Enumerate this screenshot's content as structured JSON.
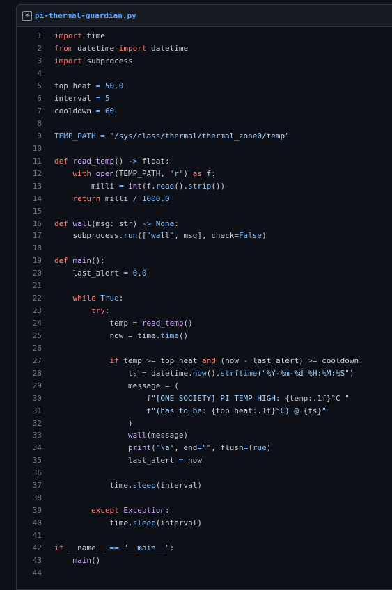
{
  "header": {
    "filename": "pi-thermal-guardian.py",
    "icon": "code-file-icon"
  },
  "code": {
    "lines": [
      [
        [
          "kw",
          "import"
        ],
        [
          "pl",
          " time"
        ]
      ],
      [
        [
          "kw",
          "from"
        ],
        [
          "pl",
          " datetime "
        ],
        [
          "kw",
          "import"
        ],
        [
          "pl",
          " datetime"
        ]
      ],
      [
        [
          "kw",
          "import"
        ],
        [
          "pl",
          " subprocess"
        ]
      ],
      [],
      [
        [
          "pl",
          "top_heat "
        ],
        [
          "op",
          "="
        ],
        [
          "pl",
          " "
        ],
        [
          "num",
          "50.0"
        ]
      ],
      [
        [
          "pl",
          "interval "
        ],
        [
          "op",
          "="
        ],
        [
          "pl",
          " "
        ],
        [
          "num",
          "5"
        ]
      ],
      [
        [
          "pl",
          "cooldown "
        ],
        [
          "op",
          "="
        ],
        [
          "pl",
          " "
        ],
        [
          "num",
          "60"
        ]
      ],
      [],
      [
        [
          "num",
          "TEMP_PATH"
        ],
        [
          "pl",
          " "
        ],
        [
          "op",
          "="
        ],
        [
          "pl",
          " "
        ],
        [
          "str",
          "\"/sys/class/thermal/thermal_zone0/temp\""
        ]
      ],
      [],
      [
        [
          "kw",
          "def"
        ],
        [
          "pl",
          " "
        ],
        [
          "fn",
          "read_temp"
        ],
        [
          "pl",
          "() "
        ],
        [
          "op",
          "->"
        ],
        [
          "pl",
          " float:"
        ]
      ],
      [
        [
          "pl",
          "    "
        ],
        [
          "kw",
          "with"
        ],
        [
          "pl",
          " "
        ],
        [
          "fn",
          "open"
        ],
        [
          "pl",
          "(TEMP_PATH, "
        ],
        [
          "str",
          "\"r\""
        ],
        [
          "pl",
          ") "
        ],
        [
          "kw",
          "as"
        ],
        [
          "pl",
          " f:"
        ]
      ],
      [
        [
          "pl",
          "        milli "
        ],
        [
          "op",
          "="
        ],
        [
          "pl",
          " "
        ],
        [
          "fn",
          "int"
        ],
        [
          "pl",
          "(f."
        ],
        [
          "mth",
          "read"
        ],
        [
          "pl",
          "()."
        ],
        [
          "mth",
          "strip"
        ],
        [
          "pl",
          "())"
        ]
      ],
      [
        [
          "pl",
          "    "
        ],
        [
          "kw",
          "return"
        ],
        [
          "pl",
          " milli "
        ],
        [
          "op",
          "/"
        ],
        [
          "pl",
          " "
        ],
        [
          "num",
          "1000.0"
        ]
      ],
      [],
      [
        [
          "kw",
          "def"
        ],
        [
          "pl",
          " "
        ],
        [
          "fn",
          "wall"
        ],
        [
          "pl",
          "(msg: str) "
        ],
        [
          "op",
          "->"
        ],
        [
          "pl",
          " "
        ],
        [
          "bi",
          "None"
        ],
        [
          "pl",
          ":"
        ]
      ],
      [
        [
          "pl",
          "    subprocess."
        ],
        [
          "mth",
          "run"
        ],
        [
          "pl",
          "(["
        ],
        [
          "str",
          "\"wall\""
        ],
        [
          "pl",
          ", msg], check"
        ],
        [
          "op",
          "="
        ],
        [
          "bi",
          "False"
        ],
        [
          "pl",
          ")"
        ]
      ],
      [],
      [
        [
          "kw",
          "def"
        ],
        [
          "pl",
          " "
        ],
        [
          "fn",
          "main"
        ],
        [
          "pl",
          "():"
        ]
      ],
      [
        [
          "pl",
          "    last_alert "
        ],
        [
          "op",
          "="
        ],
        [
          "pl",
          " "
        ],
        [
          "num",
          "0.0"
        ]
      ],
      [],
      [
        [
          "pl",
          "    "
        ],
        [
          "kw",
          "while"
        ],
        [
          "pl",
          " "
        ],
        [
          "bi",
          "True"
        ],
        [
          "pl",
          ":"
        ]
      ],
      [
        [
          "pl",
          "        "
        ],
        [
          "kw",
          "try"
        ],
        [
          "pl",
          ":"
        ]
      ],
      [
        [
          "pl",
          "            temp "
        ],
        [
          "op",
          "="
        ],
        [
          "pl",
          " "
        ],
        [
          "fn",
          "read_temp"
        ],
        [
          "pl",
          "()"
        ]
      ],
      [
        [
          "pl",
          "            now "
        ],
        [
          "op",
          "="
        ],
        [
          "pl",
          " time."
        ],
        [
          "mth",
          "time"
        ],
        [
          "pl",
          "()"
        ]
      ],
      [],
      [
        [
          "pl",
          "            "
        ],
        [
          "kw",
          "if"
        ],
        [
          "pl",
          " temp "
        ],
        [
          "op",
          ">="
        ],
        [
          "pl",
          " top_heat "
        ],
        [
          "kw",
          "and"
        ],
        [
          "pl",
          " (now "
        ],
        [
          "op",
          "-"
        ],
        [
          "pl",
          " last_alert) "
        ],
        [
          "op",
          ">="
        ],
        [
          "pl",
          " cooldown:"
        ]
      ],
      [
        [
          "pl",
          "                ts "
        ],
        [
          "op",
          "="
        ],
        [
          "pl",
          " datetime."
        ],
        [
          "mth",
          "now"
        ],
        [
          "pl",
          "()."
        ],
        [
          "mth",
          "strftime"
        ],
        [
          "pl",
          "("
        ],
        [
          "str",
          "\"%Y-%m-%d %H:%M:%S\""
        ],
        [
          "pl",
          ")"
        ]
      ],
      [
        [
          "pl",
          "                message "
        ],
        [
          "op",
          "="
        ],
        [
          "pl",
          " ("
        ]
      ],
      [
        [
          "pl",
          "                    "
        ],
        [
          "str",
          "f\"[ONE SOCIETY] PI TEMP HIGH: "
        ],
        [
          "pl",
          "{temp:.1f}"
        ],
        [
          "str",
          "°C \""
        ]
      ],
      [
        [
          "pl",
          "                    "
        ],
        [
          "str",
          "f\"(has to be: "
        ],
        [
          "pl",
          "{top_heat:.1f}"
        ],
        [
          "str",
          "°C) @ "
        ],
        [
          "pl",
          "{ts}"
        ],
        [
          "str",
          "\""
        ]
      ],
      [
        [
          "pl",
          "                )"
        ]
      ],
      [
        [
          "pl",
          "                "
        ],
        [
          "fn",
          "wall"
        ],
        [
          "pl",
          "(message)"
        ]
      ],
      [
        [
          "pl",
          "                "
        ],
        [
          "fn",
          "print"
        ],
        [
          "pl",
          "("
        ],
        [
          "str",
          "\"\\a\""
        ],
        [
          "pl",
          ", end"
        ],
        [
          "op",
          "="
        ],
        [
          "str",
          "\"\""
        ],
        [
          "pl",
          ", flush"
        ],
        [
          "op",
          "="
        ],
        [
          "bi",
          "True"
        ],
        [
          "pl",
          ")"
        ]
      ],
      [
        [
          "pl",
          "                last_alert "
        ],
        [
          "op",
          "="
        ],
        [
          "pl",
          " now"
        ]
      ],
      [],
      [
        [
          "pl",
          "            time."
        ],
        [
          "mth",
          "sleep"
        ],
        [
          "pl",
          "(interval)"
        ]
      ],
      [],
      [
        [
          "pl",
          "        "
        ],
        [
          "kw",
          "except"
        ],
        [
          "pl",
          " "
        ],
        [
          "fn",
          "Exception"
        ],
        [
          "pl",
          ":"
        ]
      ],
      [
        [
          "pl",
          "            time."
        ],
        [
          "mth",
          "sleep"
        ],
        [
          "pl",
          "(interval)"
        ]
      ],
      [],
      [
        [
          "kw",
          "if"
        ],
        [
          "pl",
          " __name__ "
        ],
        [
          "op",
          "=="
        ],
        [
          "pl",
          " "
        ],
        [
          "str",
          "\"__main__\""
        ],
        [
          "pl",
          ":"
        ]
      ],
      [
        [
          "pl",
          "    "
        ],
        [
          "fn",
          "main"
        ],
        [
          "pl",
          "()"
        ]
      ],
      []
    ]
  }
}
